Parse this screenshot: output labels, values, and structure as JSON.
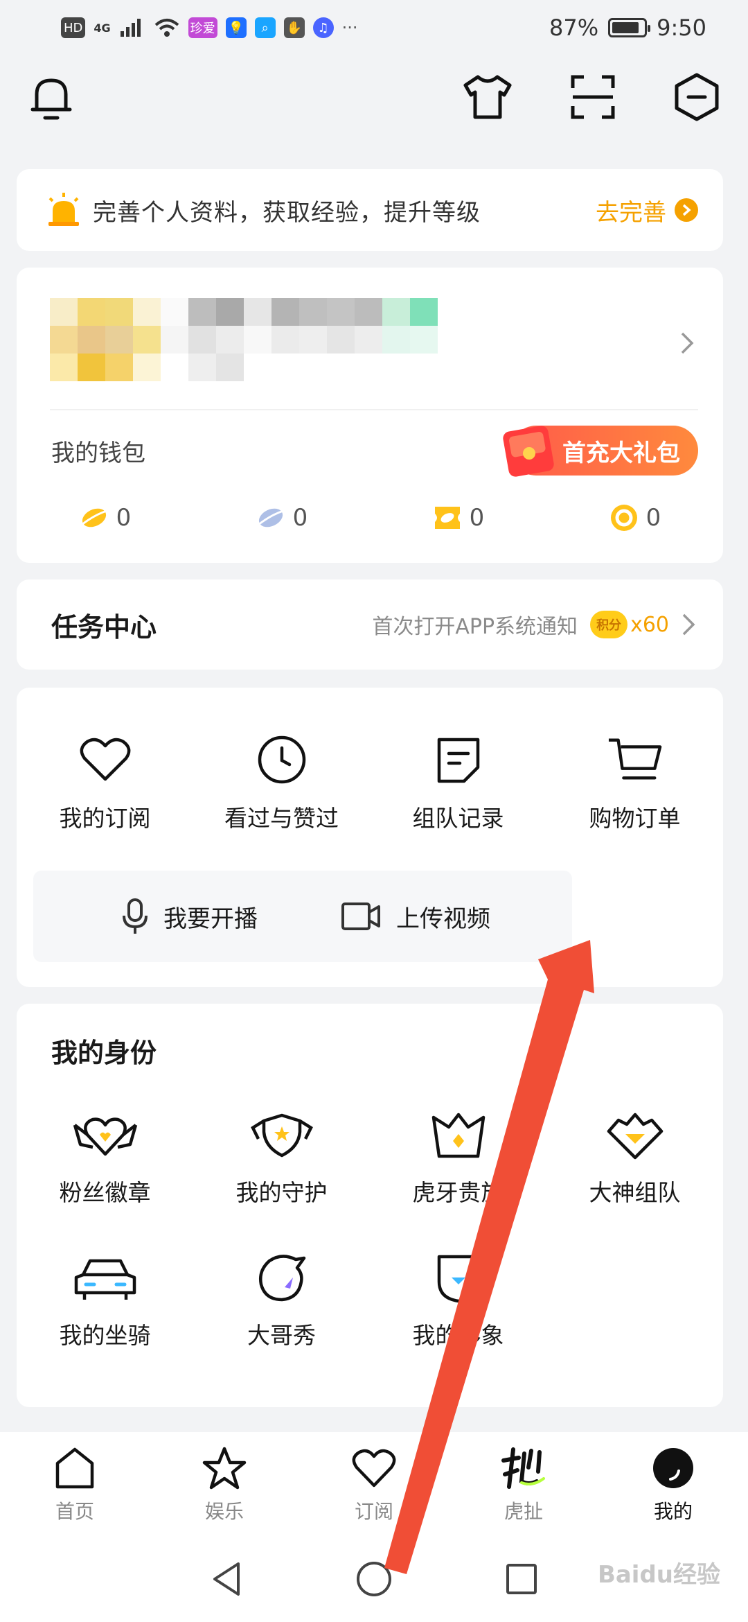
{
  "status_bar": {
    "left_badges": [
      "HD",
      "4G"
    ],
    "app_badge": "珍爱",
    "more": "···",
    "battery": "87%",
    "battery_level": 0.87,
    "time": "9:50"
  },
  "top_bar": {
    "icons": [
      "bell-icon",
      "tshirt-icon",
      "scan-icon",
      "settings-hex-icon"
    ]
  },
  "banner": {
    "text": "完善个人资料，获取经验，提升等级",
    "link": "去完善"
  },
  "wallet": {
    "label": "我的钱包",
    "gift_button": "首充大礼包",
    "items": [
      {
        "icon": "gold-bean-icon",
        "value": "0"
      },
      {
        "icon": "silver-bean-icon",
        "value": "0"
      },
      {
        "icon": "coupon-icon",
        "value": "0"
      },
      {
        "icon": "coin-icon",
        "value": "0"
      }
    ]
  },
  "task": {
    "title": "任务中心",
    "subtitle": "首次打开APP系统通知",
    "badge": "积分",
    "points": "x60"
  },
  "shortcuts": {
    "items": [
      {
        "label": "我的订阅",
        "icon": "heart-icon"
      },
      {
        "label": "看过与赞过",
        "icon": "clock-icon"
      },
      {
        "label": "组队记录",
        "icon": "note-icon"
      },
      {
        "label": "购物订单",
        "icon": "cart-icon"
      }
    ],
    "broadcast": "我要开播",
    "upload": "上传视频"
  },
  "identity": {
    "title": "我的身份",
    "items": [
      {
        "label": "粉丝徽章",
        "icon": "fan-badge-icon"
      },
      {
        "label": "我的守护",
        "icon": "guard-shield-icon"
      },
      {
        "label": "虎牙贵族",
        "icon": "crown-icon"
      },
      {
        "label": "大神组队",
        "icon": "diamond-team-icon"
      },
      {
        "label": "我的坐骑",
        "icon": "car-icon"
      },
      {
        "label": "大哥秀",
        "icon": "big-brother-icon"
      },
      {
        "label": "我的形象",
        "icon": "avatar-shield-icon"
      }
    ]
  },
  "bottom_nav": [
    {
      "label": "首页",
      "icon": "home-icon"
    },
    {
      "label": "娱乐",
      "icon": "star-icon"
    },
    {
      "label": "订阅",
      "icon": "heart-icon"
    },
    {
      "label": "虎扯",
      "icon": "huche-icon"
    },
    {
      "label": "我的",
      "icon": "me-icon"
    }
  ],
  "system_nav": [
    "back-icon",
    "home-circle-icon",
    "recents-icon"
  ],
  "watermark": "Baidu经验",
  "colors": {
    "accent": "#f5a100",
    "gift_start": "#ff5b4a",
    "gift_end": "#ff8a3d",
    "annotation_arrow": "#f04e36"
  }
}
